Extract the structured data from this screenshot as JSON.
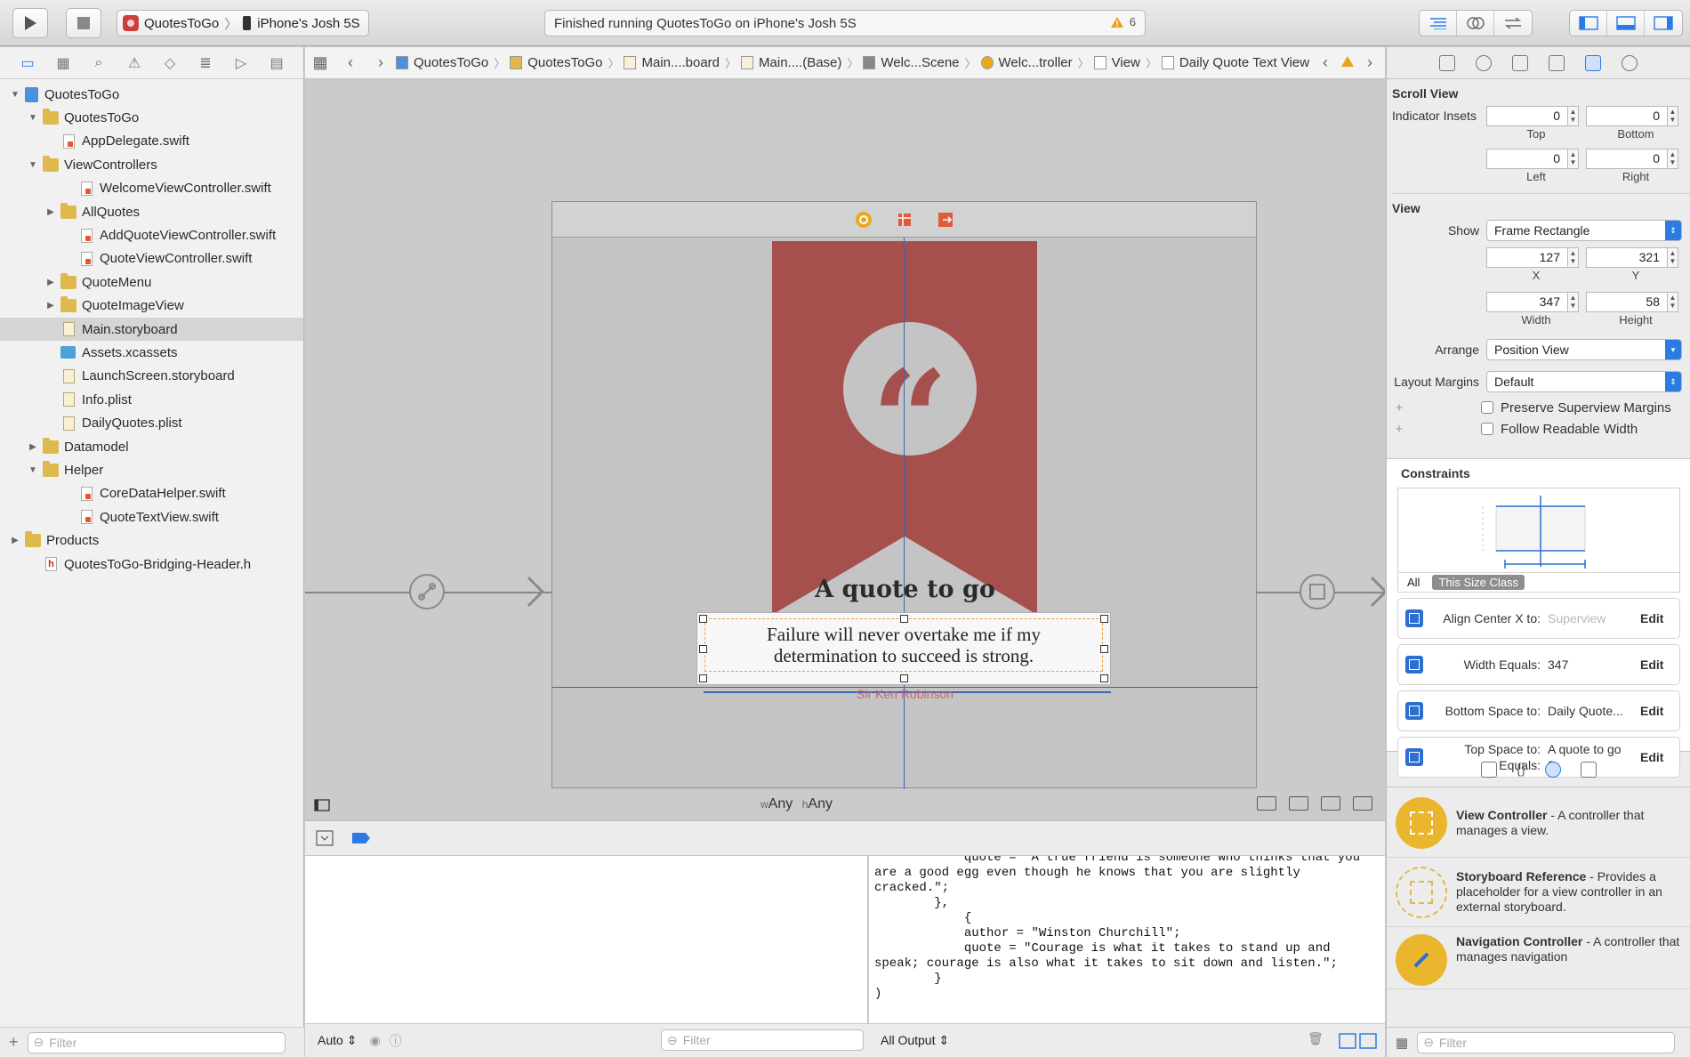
{
  "toolbar": {
    "scheme_app": "QuotesToGo",
    "scheme_device": "iPhone's Josh 5S",
    "status": "Finished running QuotesToGo on iPhone's Josh 5S",
    "warning_count": "6"
  },
  "navigator": {
    "items": [
      {
        "label": "QuotesToGo",
        "level": 0,
        "icon": "project-icon",
        "expanded": true
      },
      {
        "label": "QuotesToGo",
        "level": 1,
        "icon": "folder-icon",
        "expanded": true
      },
      {
        "label": "AppDelegate.swift",
        "level": 2,
        "icon": "swift-file-icon"
      },
      {
        "label": "ViewControllers",
        "level": 1,
        "icon": "folder-icon",
        "expanded": true
      },
      {
        "label": "WelcomeViewController.swift",
        "level": 3,
        "icon": "swift-file-icon"
      },
      {
        "label": "AllQuotes",
        "level": 2,
        "icon": "folder-icon",
        "expanded": false
      },
      {
        "label": "AddQuoteViewController.swift",
        "level": 3,
        "icon": "swift-file-icon"
      },
      {
        "label": "QuoteViewController.swift",
        "level": 3,
        "icon": "swift-file-icon"
      },
      {
        "label": "QuoteMenu",
        "level": 2,
        "icon": "folder-icon",
        "expanded": false
      },
      {
        "label": "QuoteImageView",
        "level": 2,
        "icon": "folder-icon",
        "expanded": false
      },
      {
        "label": "Main.storyboard",
        "level": 2,
        "icon": "storyboard-icon",
        "selected": true
      },
      {
        "label": "Assets.xcassets",
        "level": 2,
        "icon": "assets-icon"
      },
      {
        "label": "LaunchScreen.storyboard",
        "level": 2,
        "icon": "storyboard-icon"
      },
      {
        "label": "Info.plist",
        "level": 2,
        "icon": "plist-icon"
      },
      {
        "label": "DailyQuotes.plist",
        "level": 2,
        "icon": "plist-icon"
      },
      {
        "label": "Datamodel",
        "level": 1,
        "icon": "folder-icon",
        "expanded": false
      },
      {
        "label": "Helper",
        "level": 1,
        "icon": "folder-icon",
        "expanded": true
      },
      {
        "label": "CoreDataHelper.swift",
        "level": 3,
        "icon": "swift-file-icon"
      },
      {
        "label": "QuoteTextView.swift",
        "level": 3,
        "icon": "swift-file-icon"
      },
      {
        "label": "Products",
        "level": 0,
        "icon": "folder-icon",
        "expanded": false
      },
      {
        "label": "QuotesToGo-Bridging-Header.h",
        "level": 1,
        "icon": "header-file-icon"
      }
    ],
    "filter_placeholder": "Filter"
  },
  "jumpbar": {
    "crumbs": [
      "QuotesToGo",
      "QuotesToGo",
      "Main....board",
      "Main....(Base)",
      "Welc...Scene",
      "Welc...troller",
      "View",
      "Daily Quote Text View"
    ]
  },
  "canvas": {
    "title": "A quote to go",
    "quote": "Failure will never overtake me if my determination to succeed is strong.",
    "author": "Sir Ken Robinson",
    "size_class_w": "Any",
    "size_class_h": "Any"
  },
  "console": {
    "output": "            quote = \"A true friend is someone who thinks that you are a good egg even though he knows that you are slightly cracked.\";\n        },\n            {\n            author = \"Winston Churchill\";\n            quote = \"Courage is what it takes to stand up and speak; courage is also what it takes to sit down and listen.\";\n        }\n)",
    "output_selector": "All Output",
    "vars_mode": "Auto",
    "filter_placeholder": "Filter"
  },
  "inspector": {
    "scroll_view": {
      "title": "Scroll View",
      "indicator_label": "Indicator Insets",
      "top": "0",
      "bottom": "0",
      "left": "0",
      "right": "0",
      "top_label": "Top",
      "bottom_label": "Bottom",
      "left_label": "Left",
      "right_label": "Right"
    },
    "view": {
      "title": "View",
      "show_label": "Show",
      "show_value": "Frame Rectangle",
      "x": "127",
      "y": "321",
      "width": "347",
      "height": "58",
      "x_label": "X",
      "y_label": "Y",
      "width_label": "Width",
      "height_label": "Height",
      "arrange_label": "Arrange",
      "arrange_value": "Position View",
      "margins_label": "Layout Margins",
      "margins_value": "Default",
      "preserve_label": "Preserve Superview Margins",
      "readable_label": "Follow Readable Width"
    },
    "constraints": {
      "title": "Constraints",
      "tab_all": "All",
      "tab_size_class": "This Size Class",
      "edit": "Edit",
      "rows": [
        {
          "label": "Align Center X to:",
          "value": "Superview"
        },
        {
          "label": "Width Equals:",
          "value": "347"
        },
        {
          "label": "Bottom Space to:",
          "value": "Daily Quote..."
        },
        {
          "label": "Top Space to:",
          "label2": "Equals:",
          "value": "A quote to go",
          "value2": "8"
        }
      ]
    },
    "library": [
      {
        "name": "View Controller",
        "desc": " - A controller that manages a view."
      },
      {
        "name": "Storyboard Reference",
        "desc": " - Provides a placeholder for a view controller in an external storyboard."
      },
      {
        "name": "Navigation Controller",
        "desc": " - A controller that manages navigation"
      }
    ],
    "filter_placeholder": "Filter"
  },
  "colors": {
    "accent": "#2c7be5",
    "banner": "#a6504d",
    "guide": "#3a66b5"
  }
}
